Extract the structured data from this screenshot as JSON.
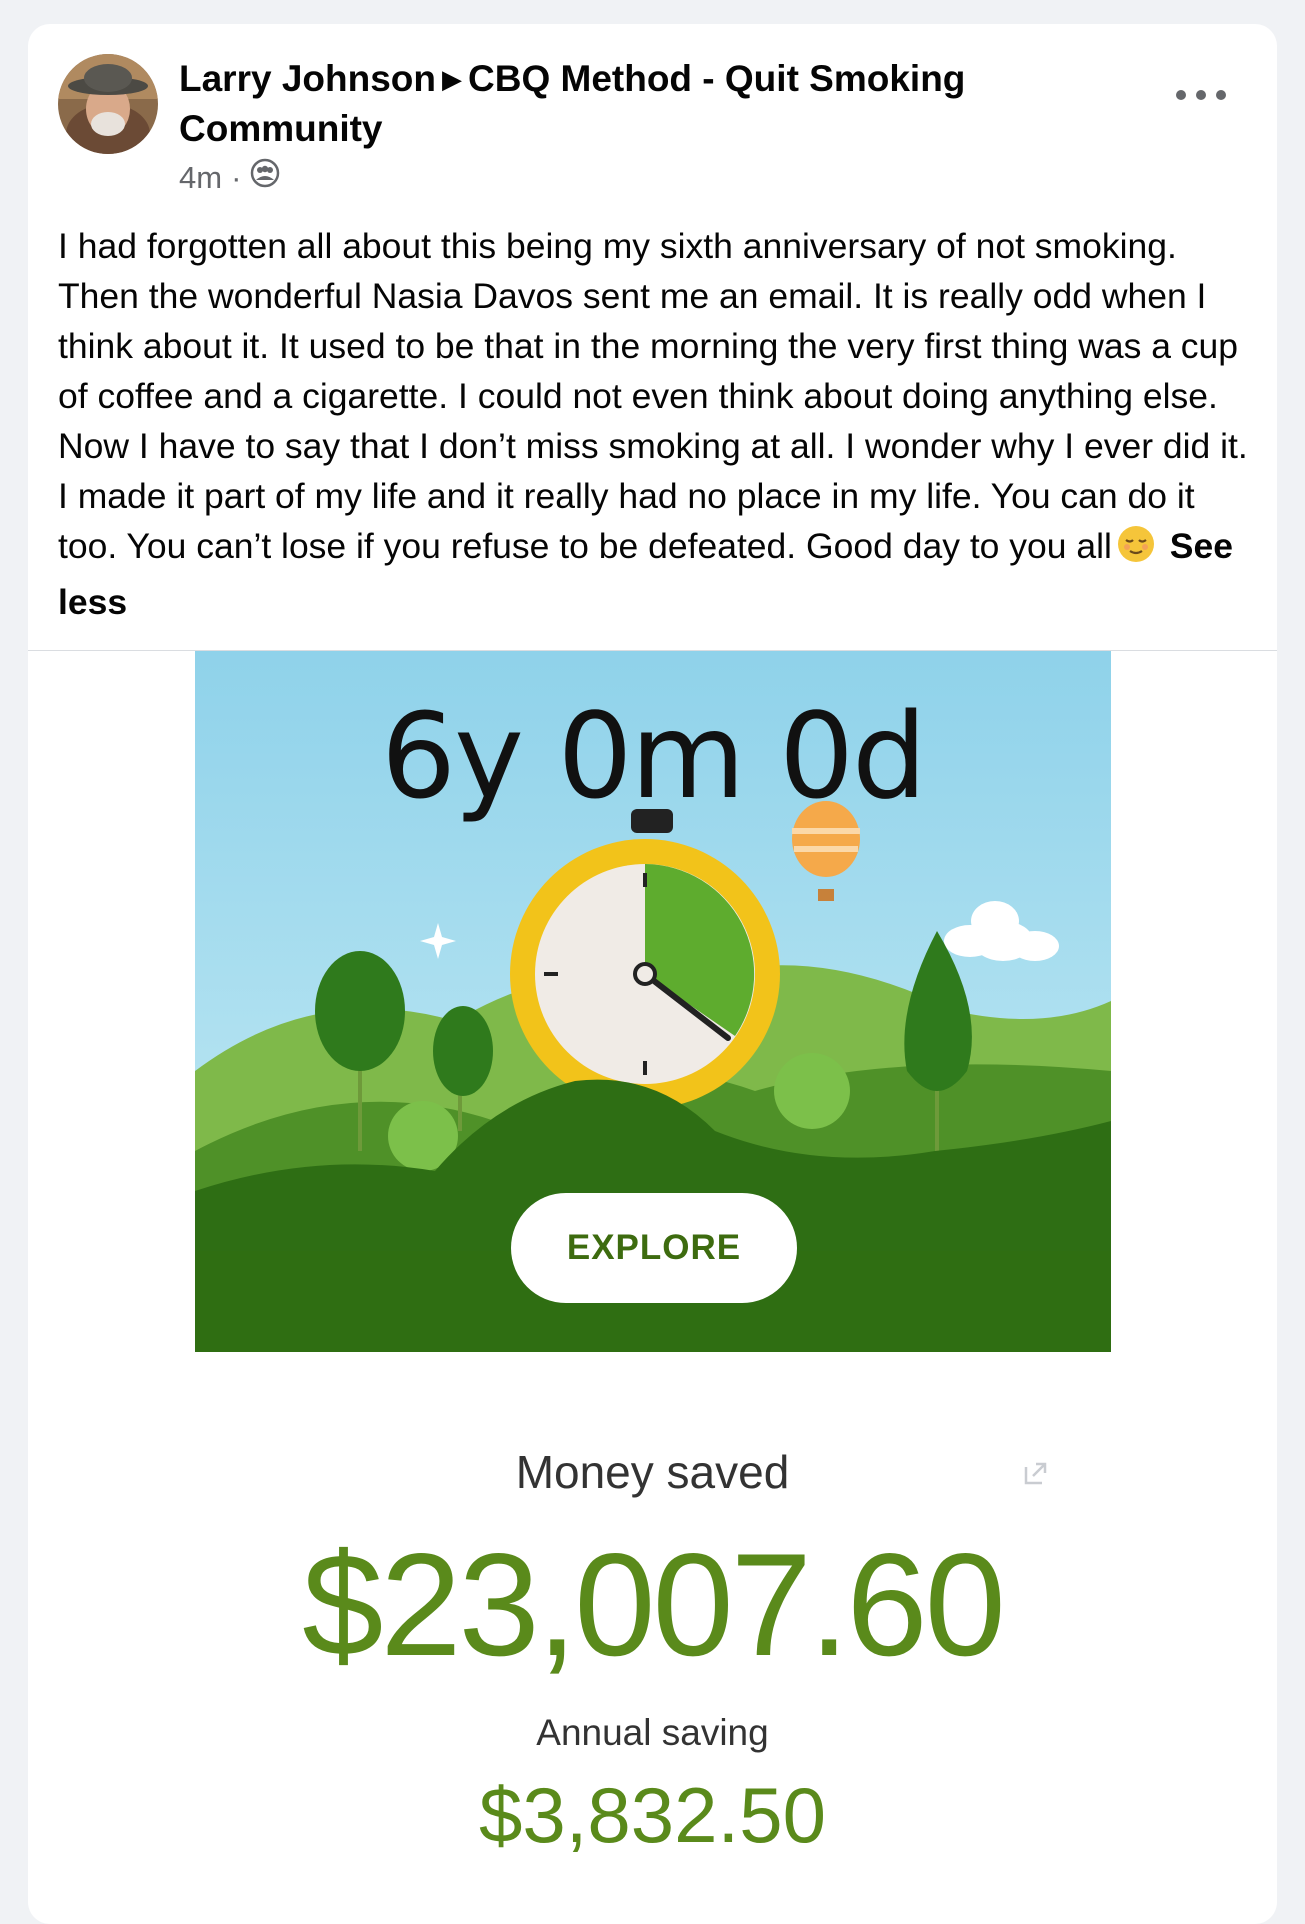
{
  "post": {
    "author": "Larry Johnson",
    "group": "CBQ Method - Quit Smoking Community",
    "time": "4m",
    "audience_icon": "group-icon",
    "more_icon": "more-options-icon",
    "text": "I had forgotten all about this being my sixth anniversary of not smoking.  Then the wonderful Nasia Davos sent me an email.  It is really odd when I think about it.  It used to be that in the morning the very first thing was a cup of coffee and a cigarette.  I could not even think about doing anything else. Now I have to say that I don’t miss smoking at all. I wonder why I ever did it.  I made it part of my life and it really had no place in my life.  You can do it too.  You can’t lose if you refuse to be defeated.  Good day to you all",
    "emoji": "😌",
    "see_less": "See less"
  },
  "app_card": {
    "counter": "6y 0m 0d",
    "explore_label": "EXPLORE",
    "money_saved_label": "Money saved",
    "money_saved_value": "$23,007.60",
    "annual_saving_label": "Annual saving",
    "annual_saving_value": "$3,832.50"
  },
  "colors": {
    "accent_green": "#5a8a1b",
    "sky": "#a7dcee",
    "hill_green": "#3f7d1a"
  }
}
